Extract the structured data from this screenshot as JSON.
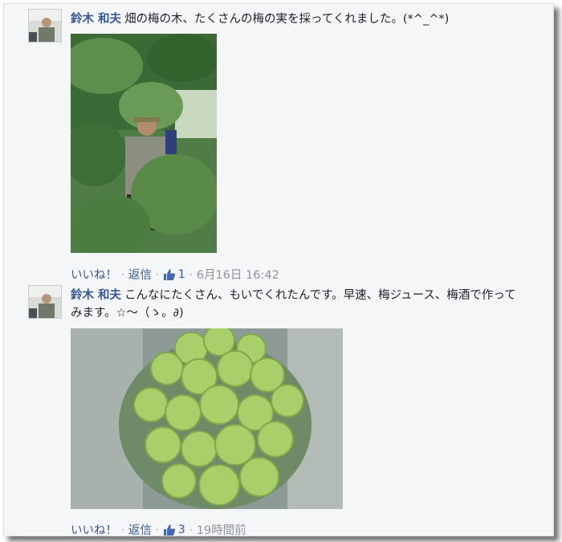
{
  "comments": [
    {
      "author": "鈴木 和夫",
      "text": "畑の梅の木、たくさんの梅の実を採ってくれました。(*^_^*)",
      "like_label": "いいね！",
      "reply_label": "返信",
      "like_count": "1",
      "timestamp": "6月16日 16:42"
    },
    {
      "author": "鈴木 和夫",
      "text": "こんなにたくさん、もいでくれたんです。早速、梅ジュース、梅酒で作ってみます。☆～（ゝ。∂)",
      "like_label": "いいね！",
      "reply_label": "返信",
      "like_count": "3",
      "timestamp": "19時間前"
    }
  ],
  "colors": {
    "link": "#365899",
    "meta": "#90949c",
    "background": "#f5f6f7"
  },
  "icons": {
    "like": "thumbs-up-icon"
  }
}
